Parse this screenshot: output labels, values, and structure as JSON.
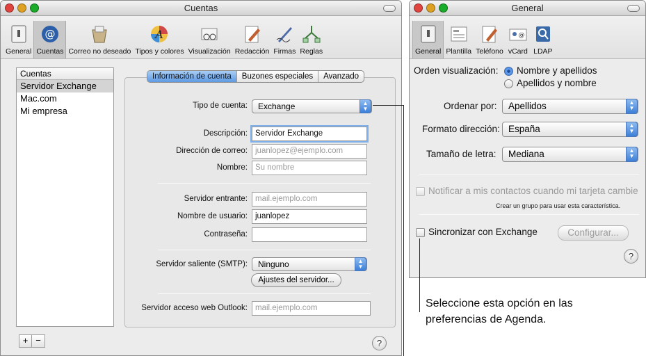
{
  "left_window": {
    "title": "Cuentas",
    "toolbar": [
      {
        "label": "General",
        "icon": "switch-icon"
      },
      {
        "label": "Cuentas",
        "icon": "at-sign-icon"
      },
      {
        "label": "Correo no deseado",
        "icon": "junk-mail-icon"
      },
      {
        "label": "Tipos y colores",
        "icon": "fonts-colors-icon"
      },
      {
        "label": "Visualización",
        "icon": "viewing-glasses-icon"
      },
      {
        "label": "Redacción",
        "icon": "composing-pencil-icon"
      },
      {
        "label": "Firmas",
        "icon": "signature-pen-icon"
      },
      {
        "label": "Reglas",
        "icon": "rules-icon"
      }
    ],
    "accounts_list": {
      "header": "Cuentas",
      "items": [
        "Servidor Exchange",
        "Mac.com",
        "Mi empresa"
      ],
      "selected": "Servidor Exchange",
      "add_label": "+",
      "remove_label": "−"
    },
    "tabs": [
      "Información de cuenta",
      "Buzones especiales",
      "Avanzado"
    ],
    "form": {
      "account_type_label": "Tipo de cuenta:",
      "account_type_value": "Exchange",
      "description_label": "Descripción:",
      "description_value": "Servidor Exchange",
      "email_label": "Dirección de correo:",
      "email_placeholder": "juanlopez@ejemplo.com",
      "name_label": "Nombre:",
      "name_placeholder": "Su nombre",
      "incoming_label": "Servidor entrante:",
      "incoming_placeholder": "mail.ejemplo.com",
      "username_label": "Nombre de usuario:",
      "username_value": "juanlopez",
      "password_label": "Contraseña:",
      "password_value": "",
      "smtp_label": "Servidor saliente (SMTP):",
      "smtp_value": "Ninguno",
      "server_settings_button": "Ajustes del servidor...",
      "owa_label": "Servidor acceso web Outlook:",
      "owa_placeholder": "mail.ejemplo.com"
    },
    "help": "?"
  },
  "right_window": {
    "title": "General",
    "toolbar": [
      {
        "label": "General",
        "icon": "switch-icon"
      },
      {
        "label": "Plantilla",
        "icon": "template-icon"
      },
      {
        "label": "Teléfono",
        "icon": "phone-format-icon"
      },
      {
        "label": "vCard",
        "icon": "vcard-icon"
      },
      {
        "label": "LDAP",
        "icon": "ldap-icon"
      }
    ],
    "display_order_label": "Orden visualización:",
    "display_order_options": [
      "Nombre y apellidos",
      "Apellidos y nombre"
    ],
    "display_order_selected": "Nombre y apellidos",
    "sort_by_label": "Ordenar por:",
    "sort_by_value": "Apellidos",
    "address_format_label": "Formato dirección:",
    "address_format_value": "España",
    "font_size_label": "Tamaño de letra:",
    "font_size_value": "Mediana",
    "notify_label": "Notificar a mis contactos cuando mi tarjeta cambie",
    "notify_hint": "Crear un grupo para usar esta característica.",
    "sync_label": "Sincronizar con Exchange",
    "configure_button": "Configurar...",
    "help": "?"
  },
  "callout": {
    "line1": "Seleccione esta opción en las",
    "line2": "preferencias de Agenda."
  },
  "colors": {
    "traffic_red": "#e0443e",
    "traffic_yellow": "#dea123",
    "traffic_green": "#1aab29",
    "selection_blue": "#5e9ae3"
  }
}
